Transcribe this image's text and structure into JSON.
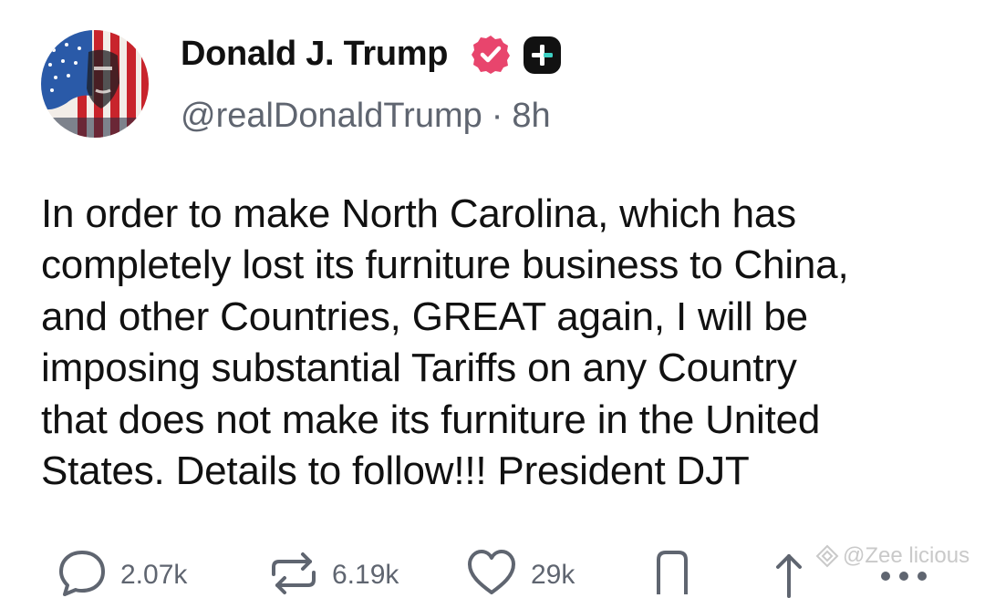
{
  "author": {
    "display_name": "Donald J. Trump",
    "handle": "@realDonaldTrump",
    "separator": "·",
    "time_ago": "8h",
    "verified_icon": "verified-badge-icon",
    "plus_icon": "plus-badge-icon",
    "verified_color": "#e8456d"
  },
  "post": {
    "text": "In order to make North Carolina, which has\ncompletely lost its furniture business to China,\nand other Countries, GREAT again, I will be\nimposing substantial Tariffs on any Country\nthat does not make its furniture in the United\nStates. Details to follow!!! President DJT"
  },
  "actions": {
    "reply": {
      "icon": "reply-icon",
      "count": "2.07k"
    },
    "retruth": {
      "icon": "retruth-icon",
      "count": "6.19k"
    },
    "like": {
      "icon": "heart-icon",
      "count": "29k"
    },
    "bookmark": {
      "icon": "bookmark-icon"
    },
    "share": {
      "icon": "share-icon"
    },
    "more": {
      "icon": "more-icon"
    }
  },
  "watermark": {
    "text": "@Zee licious"
  }
}
